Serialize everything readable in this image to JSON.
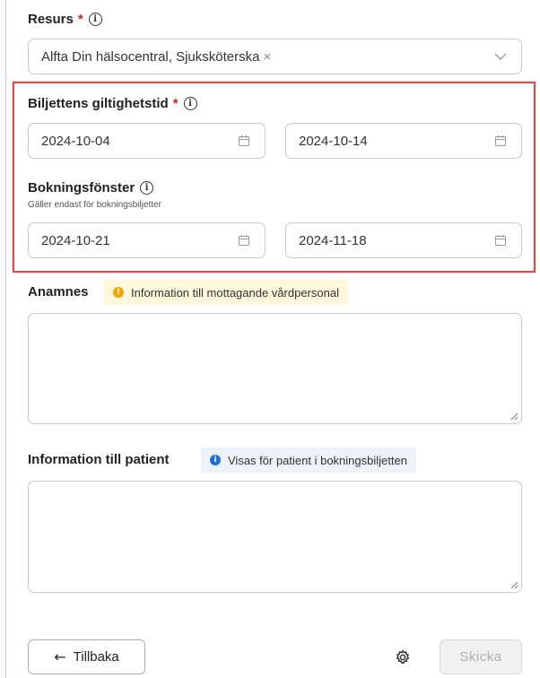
{
  "resource": {
    "label": "Resurs",
    "required_mark": "*",
    "value": "Alfta Din hälsocentral, Sjuksköterska",
    "remove_glyph": "×"
  },
  "validity": {
    "label": "Biljettens giltighetstid",
    "required_mark": "*",
    "from": "2024-10-04",
    "to": "2024-10-14"
  },
  "booking_window": {
    "label": "Bokningsfönster",
    "hint": "Gäller endast för bokningsbiljetter",
    "from": "2024-10-21",
    "to": "2024-11-18"
  },
  "anamnes": {
    "label": "Anamnes",
    "badge_text": "Information till mottagande vårdpersonal",
    "value": ""
  },
  "patient_info": {
    "label": "Information till patient",
    "badge_text": "Visas för patient i bokningsbiljetten",
    "value": ""
  },
  "footer": {
    "back_label": "Tillbaka",
    "back_arrow": "←",
    "send_label": "Skicka"
  },
  "colors": {
    "highlight": "#e04a4a",
    "required": "#d3202b",
    "warning_dot": "#f0a500",
    "info_dot": "#1a6fe0"
  }
}
